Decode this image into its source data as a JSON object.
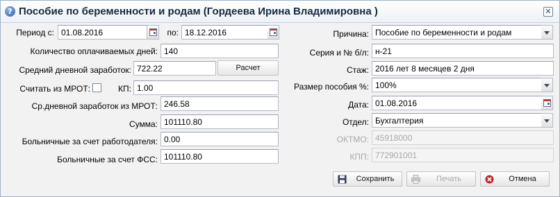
{
  "window": {
    "title": "Пособие по беременности и родам (Гордеева Ирина Владимировна )",
    "close_glyph": "✕",
    "help_glyph": "?"
  },
  "left": {
    "period_from_label": "Период с:",
    "period_from_value": "01.08.2016",
    "period_to_label": "по:",
    "period_to_value": "18.12.2016",
    "paid_days_label": "Количество оплачиваемых дней:",
    "paid_days_value": "140",
    "avg_daily_label": "Средний дневной заработок:",
    "avg_daily_value": "722.22",
    "calc_button": "Расчет",
    "from_mrot_label": "Считать из МРОТ:",
    "kp_label": "КП:",
    "kp_value": "1.00",
    "avg_daily_mrot_label": "Ср.дневной заработок из МРОТ:",
    "avg_daily_mrot_value": "246.58",
    "sum_label": "Сумма:",
    "sum_value": "101110.80",
    "employer_label": "Больничные за счет работодателя:",
    "employer_value": "0.00",
    "fss_label": "Больничные за счет ФСС:",
    "fss_value": "101110.80"
  },
  "right": {
    "reason_label": "Причина:",
    "reason_value": "Пособие по беременности и родам",
    "series_label": "Серия и № б/л:",
    "series_value": "н-21",
    "experience_label": "Стаж:",
    "experience_value": "2016 лет 8 месяцев 2 дня",
    "benefit_pct_label": "Размер пособия %:",
    "benefit_pct_value": "100%",
    "date_label": "Дата:",
    "date_value": "01.08.2016",
    "dept_label": "Отдел:",
    "dept_value": "Бухгалтерия",
    "oktmo_label": "ОКТМО:",
    "oktmo_value": "45918000",
    "kpp_label": "КПП:",
    "kpp_value": "772901001"
  },
  "footer": {
    "save_button": "Сохранить",
    "print_button": "Печать",
    "cancel_button": "Отмена"
  },
  "icons": {
    "help": "help-icon",
    "close": "close-icon",
    "calendar": "calendar-icon",
    "dropdown": "chevron-down-icon",
    "save": "floppy-disk-icon",
    "print": "printer-icon",
    "cancel": "cancel-icon"
  },
  "colors": {
    "title_text": "#15283f",
    "window_bg": "#f2f2f2",
    "disabled_text": "#a9a9a9",
    "cancel_red": "#c62828"
  }
}
